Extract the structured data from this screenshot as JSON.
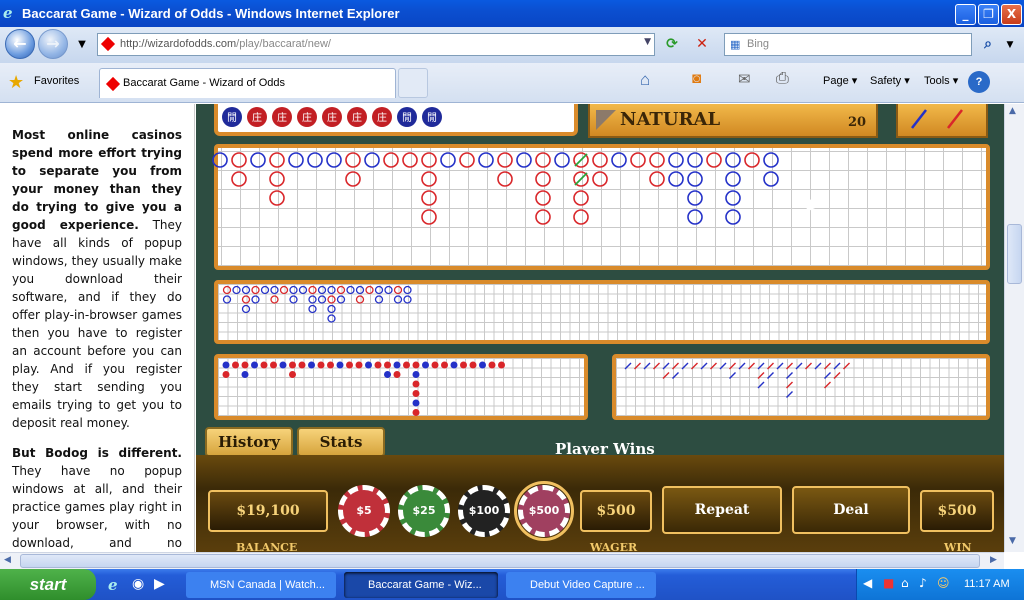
{
  "window": {
    "title": "Baccarat Game - Wizard of Odds - Windows Internet Explorer",
    "buttons": {
      "minimize": "_",
      "maximize": "❐",
      "close": "X"
    }
  },
  "nav": {
    "url": "http://wizardofodds.com/play/baccarat/new/",
    "url_host": "http://wizardofodds.com",
    "url_path": "/play/baccarat/new/",
    "search_placeholder": "Bing",
    "back_glyph": "←",
    "forward_glyph": "→"
  },
  "favbar": {
    "favorites_label": "Favorites",
    "tab_title": "Baccarat Game - Wizard of Odds",
    "commands": {
      "page": "Page ▾",
      "safety": "Safety ▾",
      "tools": "Tools ▾",
      "help": "?"
    }
  },
  "article": {
    "p1_lead": "Most online casinos spend more effort trying to separate you from your money than they do trying to give you a good experience.",
    "p1_rest": "They have all kinds of popup windows, they usually make you download their software, and if they do offer play-in-browser games then you have to register an account before you can play. And if you register they start sending you emails trying to get you to deposit real money.",
    "p2_lead": "But Bodog is different.",
    "p2_rest": "They have no popup windows at all, and their practice games play right in your browser, with no download, and no registration required."
  },
  "game": {
    "top_chips": [
      "閒",
      "庄",
      "庄",
      "庄",
      "庄",
      "庄",
      "庄",
      "閒",
      "閒"
    ],
    "natural_label": "NATURAL",
    "natural_value": "20",
    "history_tab": "History",
    "stats_tab": "Stats",
    "status": "Player Wins",
    "balance": "$19,100",
    "balance_label": "BALANCE",
    "chips": [
      "$5",
      "$25",
      "$100",
      "$500"
    ],
    "wager": "$500",
    "wager_label": "WAGER",
    "repeat_label": "Repeat",
    "deal_label": "Deal",
    "win": "$500",
    "win_label": "WIN"
  },
  "taskbar": {
    "start": "start",
    "tasks": [
      "MSN Canada | Watch...",
      "Baccarat Game - Wiz...",
      "Debut Video Capture ..."
    ],
    "clock": "11:17 AM"
  },
  "colors": {
    "banker": "#d9262a",
    "player": "#2431c8",
    "tie": "#2aa43a",
    "frame": "#d98b2b"
  }
}
